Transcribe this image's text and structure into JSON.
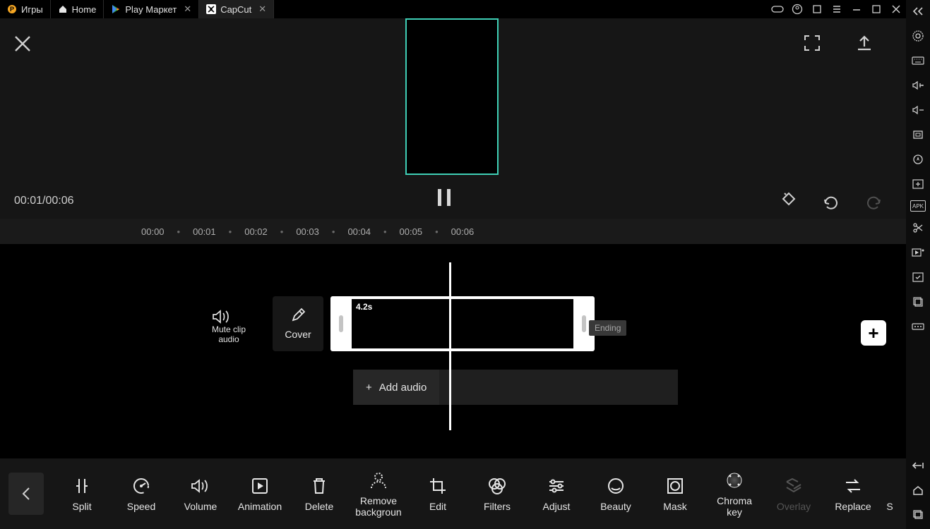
{
  "titlebar": {
    "tabs": [
      {
        "label": "Игры",
        "icon": "logo"
      },
      {
        "label": "Home",
        "icon": "home"
      },
      {
        "label": "Play Маркет",
        "icon": "play",
        "close": true
      },
      {
        "label": "CapCut",
        "icon": "capcut",
        "close": true,
        "active": true
      }
    ]
  },
  "player": {
    "current": "00:01",
    "total": "00:06",
    "timecode": "00:01/00:06"
  },
  "ruler": [
    "00:00",
    "00:01",
    "00:02",
    "00:03",
    "00:04",
    "00:05",
    "00:06"
  ],
  "tracks": {
    "mute_line1": "Mute clip",
    "mute_line2": "audio",
    "cover": "Cover",
    "clip_duration": "4.2s",
    "ending": "Ending",
    "add_audio": "Add audio"
  },
  "tools": [
    {
      "key": "split",
      "label": "Split"
    },
    {
      "key": "speed",
      "label": "Speed"
    },
    {
      "key": "volume",
      "label": "Volume"
    },
    {
      "key": "animation",
      "label": "Animation"
    },
    {
      "key": "delete",
      "label": "Delete"
    },
    {
      "key": "removebg",
      "label": "Remove backgroun"
    },
    {
      "key": "edit",
      "label": "Edit"
    },
    {
      "key": "filters",
      "label": "Filters"
    },
    {
      "key": "adjust",
      "label": "Adjust"
    },
    {
      "key": "beauty",
      "label": "Beauty"
    },
    {
      "key": "mask",
      "label": "Mask"
    },
    {
      "key": "chroma",
      "label": "Chroma key"
    },
    {
      "key": "overlay",
      "label": "Overlay",
      "disabled": true
    },
    {
      "key": "replace",
      "label": "Replace"
    },
    {
      "key": "s",
      "label": "S"
    }
  ],
  "colors": {
    "accent": "#3fcfb6"
  }
}
